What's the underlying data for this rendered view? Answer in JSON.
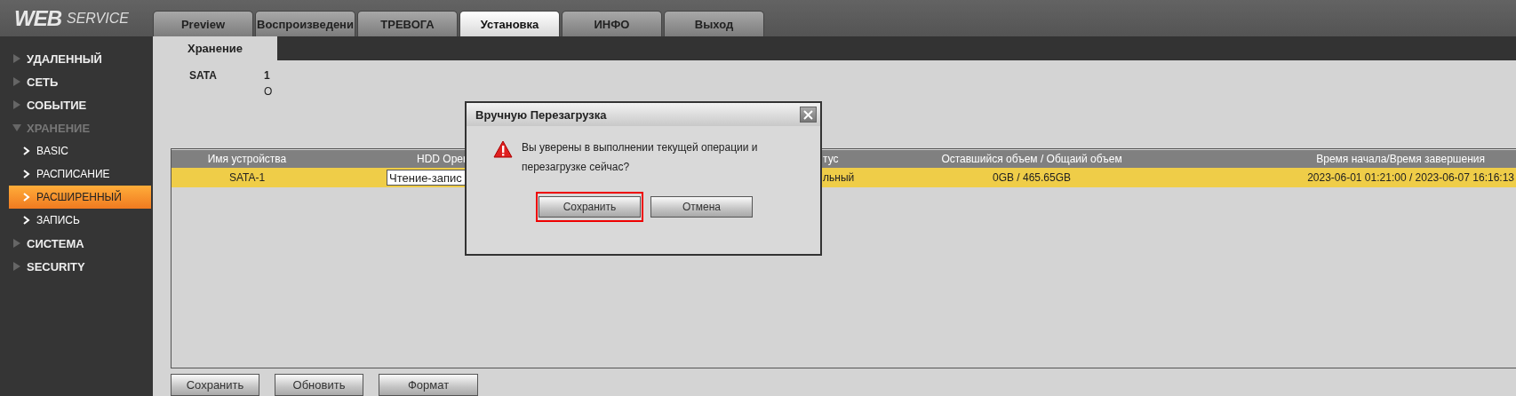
{
  "logo": {
    "primary": "WEB",
    "secondary": "SERVICE"
  },
  "tabs": [
    {
      "label": "Preview",
      "selected": false
    },
    {
      "label": "Воспроизведени",
      "selected": false
    },
    {
      "label": "ТРЕВОГА",
      "selected": false
    },
    {
      "label": "Установка",
      "selected": true
    },
    {
      "label": "ИНФО",
      "selected": false
    },
    {
      "label": "Выход",
      "selected": false
    }
  ],
  "sidebar": {
    "items": [
      {
        "label": "УДАЛЕННЫЙ",
        "expanded": false
      },
      {
        "label": "СЕТЬ",
        "expanded": false
      },
      {
        "label": "СОБЫТИЕ",
        "expanded": false
      },
      {
        "label": "ХРАНЕНИЕ",
        "expanded": true,
        "children": [
          {
            "label": "BASIC",
            "selected": false
          },
          {
            "label": "РАСПИСАНИЕ",
            "selected": false
          },
          {
            "label": "РАСШИРЕННЫЙ",
            "selected": true
          },
          {
            "label": "ЗАПИСЬ",
            "selected": false
          }
        ]
      },
      {
        "label": "СИСТЕМА",
        "expanded": false
      },
      {
        "label": "SECURITY",
        "expanded": false
      }
    ]
  },
  "subtabs": [
    {
      "label": "Хранение",
      "selected": true
    }
  ],
  "disk_info": {
    "label": "SATA",
    "values": [
      "1",
      "O"
    ]
  },
  "table": {
    "columns": [
      "Имя устройства",
      "HDD Oper",
      "тус",
      "Оставшийся объем / Общаий объем",
      "Время начала/Время завершения"
    ],
    "rows": [
      {
        "device": "SATA-1",
        "hdd_operation": "Чтение-запис",
        "status": "льный",
        "capacity": "0GB / 465.65GB",
        "time": "2023-06-01 01:21:00 / 2023-06-07 16:16:13",
        "selected": true
      }
    ]
  },
  "buttons": [
    "Сохранить",
    "Обновить",
    "Формат"
  ],
  "dialog": {
    "title": "Вручную Перезагрузка",
    "message": "Вы уверены в выполнении текущей операции и перезагрузке сейчас?",
    "buttons": [
      {
        "label": "Сохранить",
        "highlighted": true
      },
      {
        "label": "Отмена",
        "highlighted": false
      }
    ]
  }
}
